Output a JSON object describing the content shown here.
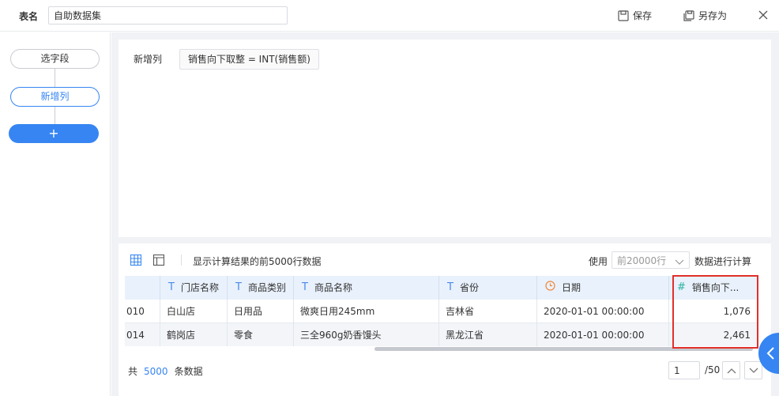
{
  "header": {
    "table_name_label": "表名",
    "table_name_value": "自助数据集",
    "save_label": "保存",
    "save_as_label": "另存为"
  },
  "steps": {
    "items": [
      {
        "label": "选字段",
        "active": false
      },
      {
        "label": "新增列",
        "active": true
      }
    ],
    "add_label": "+"
  },
  "formula": {
    "label": "新增列",
    "expression": "销售向下取整 = INT(销售额)"
  },
  "preview": {
    "hint": "显示计算结果的前5000行数据",
    "use_label": "使用",
    "use_select_value": "前20000行",
    "use_suffix": "数据进行计算",
    "columns": [
      {
        "label": "",
        "type": ""
      },
      {
        "label": "门店名称",
        "type": "text"
      },
      {
        "label": "商品类别",
        "type": "text"
      },
      {
        "label": "商品名称",
        "type": "text"
      },
      {
        "label": "省份",
        "type": "text"
      },
      {
        "label": "日期",
        "type": "date"
      },
      {
        "label": "销售向下...",
        "type": "number"
      }
    ],
    "rows": [
      [
        "010",
        "白山店",
        "日用品",
        "微爽日用245mm",
        "吉林省",
        "2020-01-01 00:00:00",
        "1,076"
      ],
      [
        "014",
        "鹤岗店",
        "零食",
        "三全960g奶香馒头",
        "黑龙江省",
        "2020-01-01 00:00:00",
        "2,461"
      ]
    ]
  },
  "footer": {
    "total_prefix": "共",
    "total_count": "5000",
    "total_suffix": "条数据",
    "page_value": "1",
    "page_total": "/50"
  },
  "colors": {
    "accent": "#3685f2",
    "highlight": "#e2302a",
    "header_bg": "#e9f1fc"
  }
}
